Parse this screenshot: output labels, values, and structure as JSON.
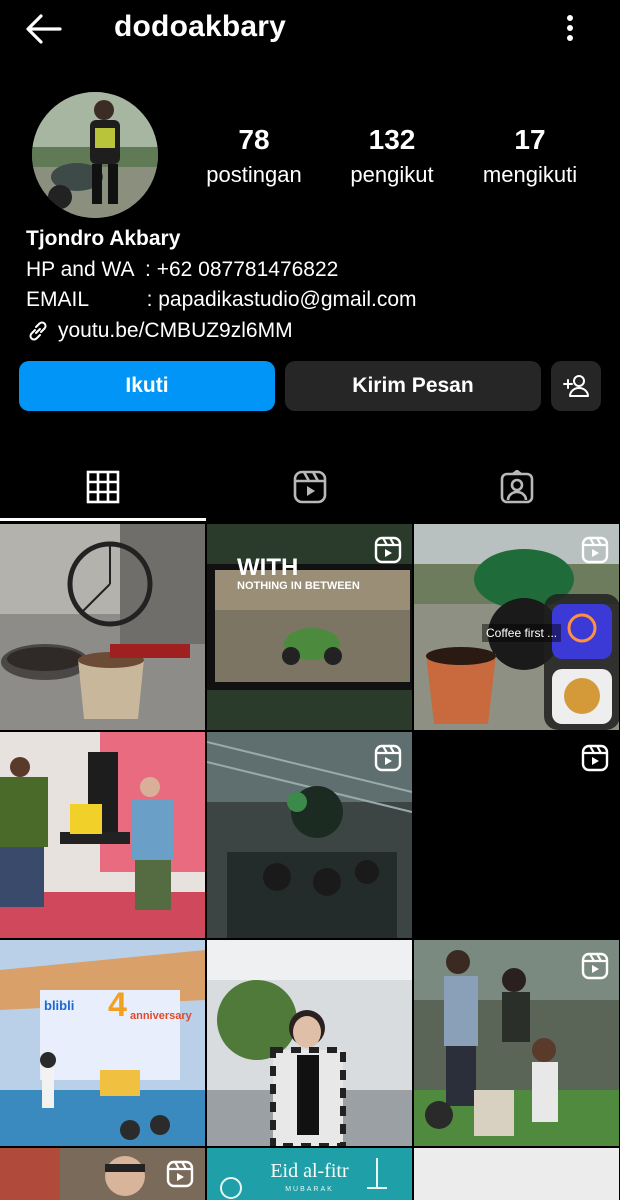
{
  "header": {
    "username": "dodoakbary"
  },
  "profile": {
    "stats": [
      {
        "value": "78",
        "label": "postingan"
      },
      {
        "value": "132",
        "label": "pengikut"
      },
      {
        "value": "17",
        "label": "mengikuti"
      }
    ],
    "bio": {
      "name": "Tjondro Akbary",
      "lines": [
        "HP and WA  : +62 087781476822",
        "EMAIL          : papadikastudio@gmail.com"
      ],
      "link": "youtu.be/CMBUZ9zl6MM"
    }
  },
  "actions": {
    "follow_label": "Ikuti",
    "message_label": "Kirim Pesan"
  },
  "tabs": [
    {
      "name": "posts-grid",
      "active": true
    },
    {
      "name": "reels",
      "active": false
    },
    {
      "name": "tagged",
      "active": false
    }
  ],
  "grid_overlays": {
    "cell2_title": "WITH",
    "cell2_subtitle": "NOTHING IN BETWEEN",
    "cell3_caption": "Coffee first ...",
    "cell7_text1": "blibli",
    "cell7_text2": "4",
    "cell7_text3": "anniversary",
    "cell11_title": "Eid al-fitr",
    "cell11_subtitle": "MUBARAK"
  },
  "colors": {
    "accent": "#0095f6",
    "secondary_button": "#262626",
    "background": "#000000"
  }
}
